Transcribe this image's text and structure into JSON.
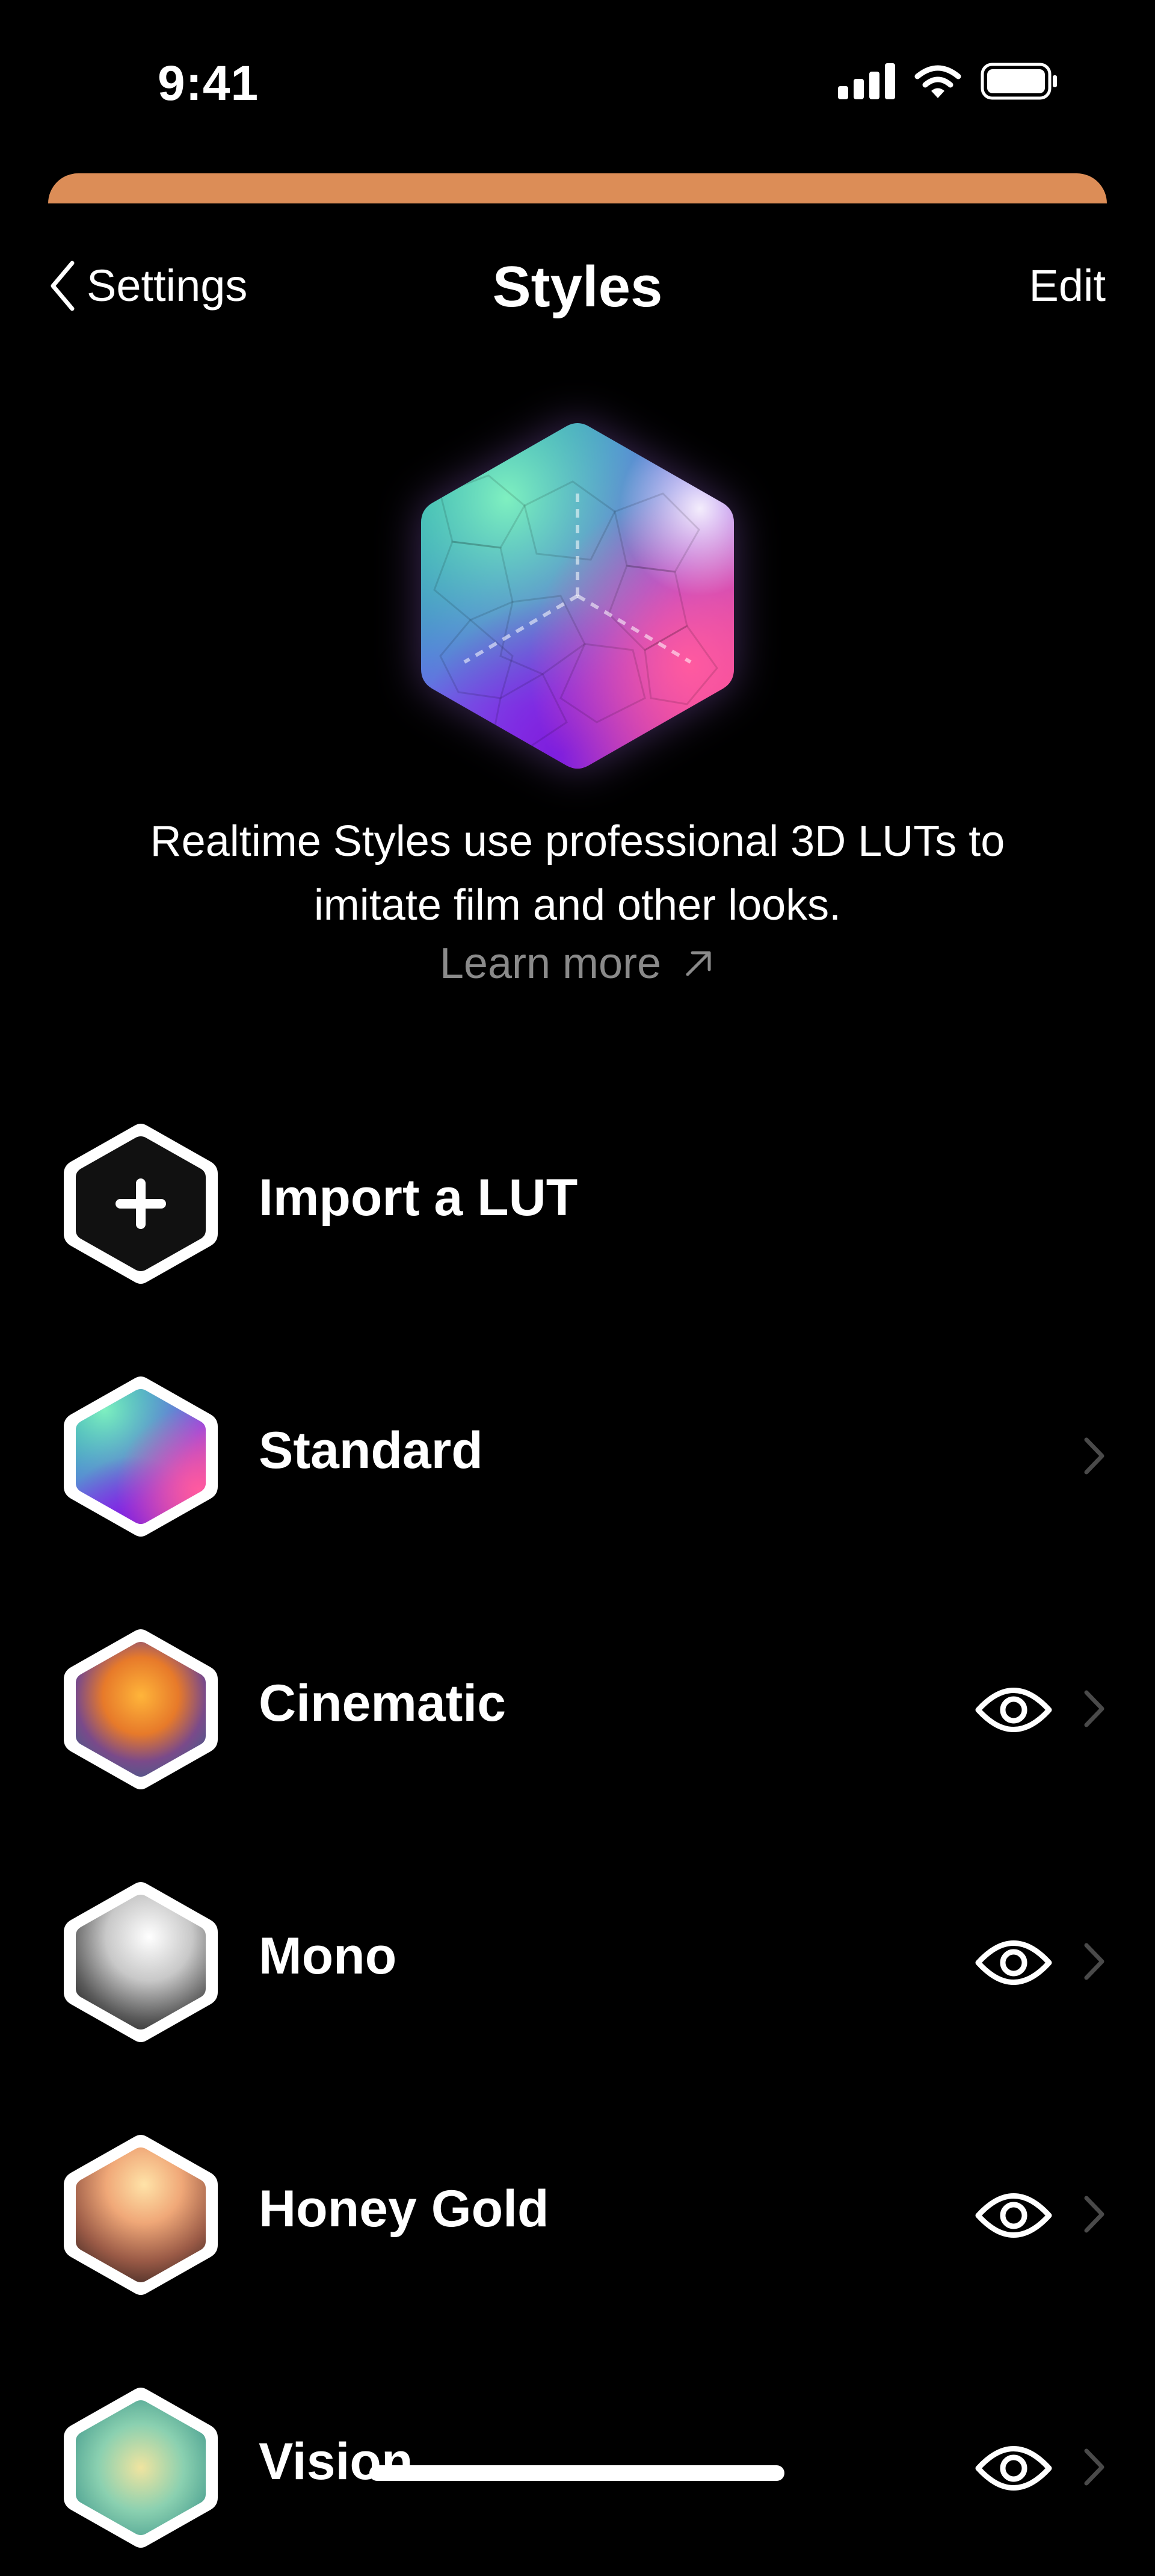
{
  "status_bar": {
    "time": "9:41",
    "icons": [
      "cellular-signal-icon",
      "wifi-icon",
      "battery-icon"
    ]
  },
  "nav": {
    "back_label": "Settings",
    "title": "Styles",
    "edit_label": "Edit"
  },
  "hero": {
    "description_line1": "Realtime Styles use professional 3D LUTs to",
    "description_line2": "imitate film and other looks.",
    "learn_more": "Learn more"
  },
  "styles": [
    {
      "label": "Import a LUT",
      "icon": "plus-icon",
      "preview": false,
      "chevron": false
    },
    {
      "label": "Standard",
      "icon": "standard-lut-icon",
      "preview": false,
      "chevron": true
    },
    {
      "label": "Cinematic",
      "icon": "cinematic-lut-icon",
      "preview": true,
      "chevron": true
    },
    {
      "label": "Mono",
      "icon": "mono-lut-icon",
      "preview": true,
      "chevron": true
    },
    {
      "label": "Honey Gold",
      "icon": "honey-gold-lut-icon",
      "preview": true,
      "chevron": true
    },
    {
      "label": "Vision",
      "icon": "vision-lut-icon",
      "preview": true,
      "chevron": true
    }
  ],
  "colors": {
    "background": "#000000",
    "sheet_accent": "#dc8d57",
    "secondary_text": "#8a8a8a",
    "chevron": "#4a4a4a"
  }
}
